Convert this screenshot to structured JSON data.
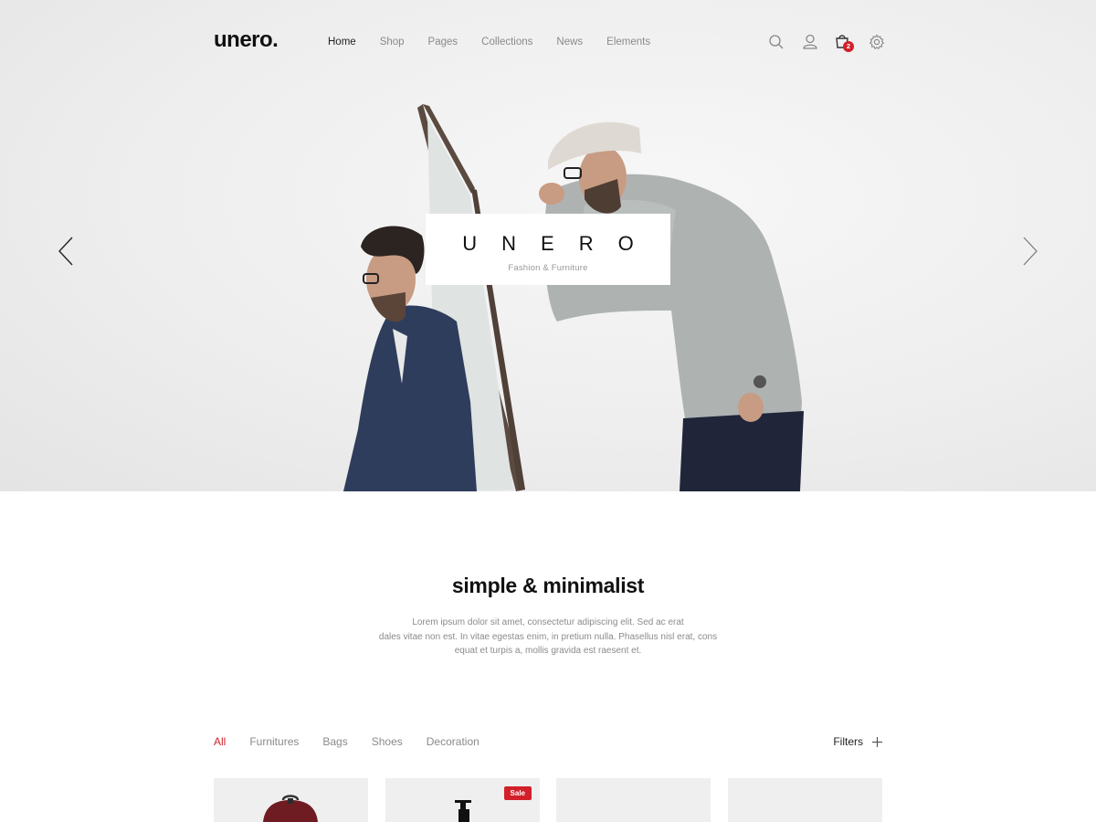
{
  "header": {
    "logo": "unero.",
    "nav": [
      {
        "label": "Home",
        "active": true
      },
      {
        "label": "Shop",
        "active": false
      },
      {
        "label": "Pages",
        "active": false
      },
      {
        "label": "Collections",
        "active": false
      },
      {
        "label": "News",
        "active": false
      },
      {
        "label": "Elements",
        "active": false
      }
    ],
    "icons": [
      "search-icon",
      "user-icon",
      "cart-icon",
      "settings-icon"
    ],
    "cart_count": "2"
  },
  "hero": {
    "title": "UNERO",
    "subtitle": "Fashion & Furniture",
    "prev_icon": "chevron-left-icon",
    "next_icon": "chevron-right-icon"
  },
  "intro": {
    "title": "simple & minimalist",
    "text_lines": [
      "Lorem ipsum dolor sit amet, consectetur adipiscing elit. Sed ac erat",
      "dales vitae non est. In vitae egestas enim, in pretium nulla. Phasellus nisl erat, cons",
      "equat et turpis a, mollis gravida est raesent et."
    ]
  },
  "filters": {
    "tabs": [
      {
        "label": "All",
        "active": true
      },
      {
        "label": "Furnitures",
        "active": false
      },
      {
        "label": "Bags",
        "active": false
      },
      {
        "label": "Shoes",
        "active": false
      },
      {
        "label": "Decoration",
        "active": false
      }
    ],
    "filters_label": "Filters"
  },
  "products": [
    {
      "badge": ""
    },
    {
      "badge": "Sale"
    },
    {
      "badge": ""
    },
    {
      "badge": ""
    }
  ],
  "colors": {
    "accent": "#d2202a",
    "text_dark": "#111111",
    "text_muted": "#8a8a8a",
    "hero_bg": "#eeeeee",
    "card_bg": "#efefef"
  }
}
